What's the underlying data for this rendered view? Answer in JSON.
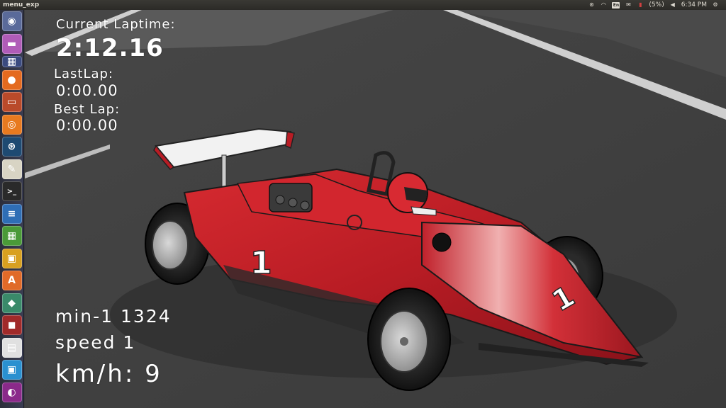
{
  "window": {
    "title": "menu_exp"
  },
  "tray": {
    "battery": "(5%)",
    "clock": "6:34 PM",
    "keyboard": "En"
  },
  "launcher": {
    "items": [
      {
        "name": "dash-home",
        "color": "#5a6a9a"
      },
      {
        "name": "app-1",
        "color": "#b05cb8"
      },
      {
        "name": "workspace-switcher",
        "color": "#3a4a80"
      },
      {
        "name": "firefox",
        "color": "#e46a1f"
      },
      {
        "name": "files",
        "color": "#b94a2a"
      },
      {
        "name": "blender",
        "color": "#e87a20"
      },
      {
        "name": "steam",
        "color": "#1e4a72"
      },
      {
        "name": "text-editor",
        "color": "#d8d4c4"
      },
      {
        "name": "terminal",
        "color": "#2a2a2a"
      },
      {
        "name": "writer",
        "color": "#2f6eb5"
      },
      {
        "name": "calc",
        "color": "#4a9a38"
      },
      {
        "name": "impress",
        "color": "#d8a020"
      },
      {
        "name": "software-center",
        "color": "#e06a28"
      },
      {
        "name": "app-2",
        "color": "#3a8a6a"
      },
      {
        "name": "app-3",
        "color": "#a02a2a"
      },
      {
        "name": "app-4",
        "color": "#e0e0e0"
      },
      {
        "name": "app-5",
        "color": "#2a90d0"
      },
      {
        "name": "app-6",
        "color": "#8a2a8a"
      }
    ]
  },
  "hud": {
    "current_laptime_label": "Current Laptime:",
    "current_laptime": "2:12.16",
    "last_lap_label": "LastLap:",
    "last_lap": "0:00.00",
    "best_lap_label": "Best Lap:",
    "best_lap": "0:00.00",
    "rpm": "min-1 1324",
    "gear": "speed 1",
    "speed": "km/h: 9"
  },
  "car": {
    "number": "1",
    "body_color": "#c8222a"
  }
}
